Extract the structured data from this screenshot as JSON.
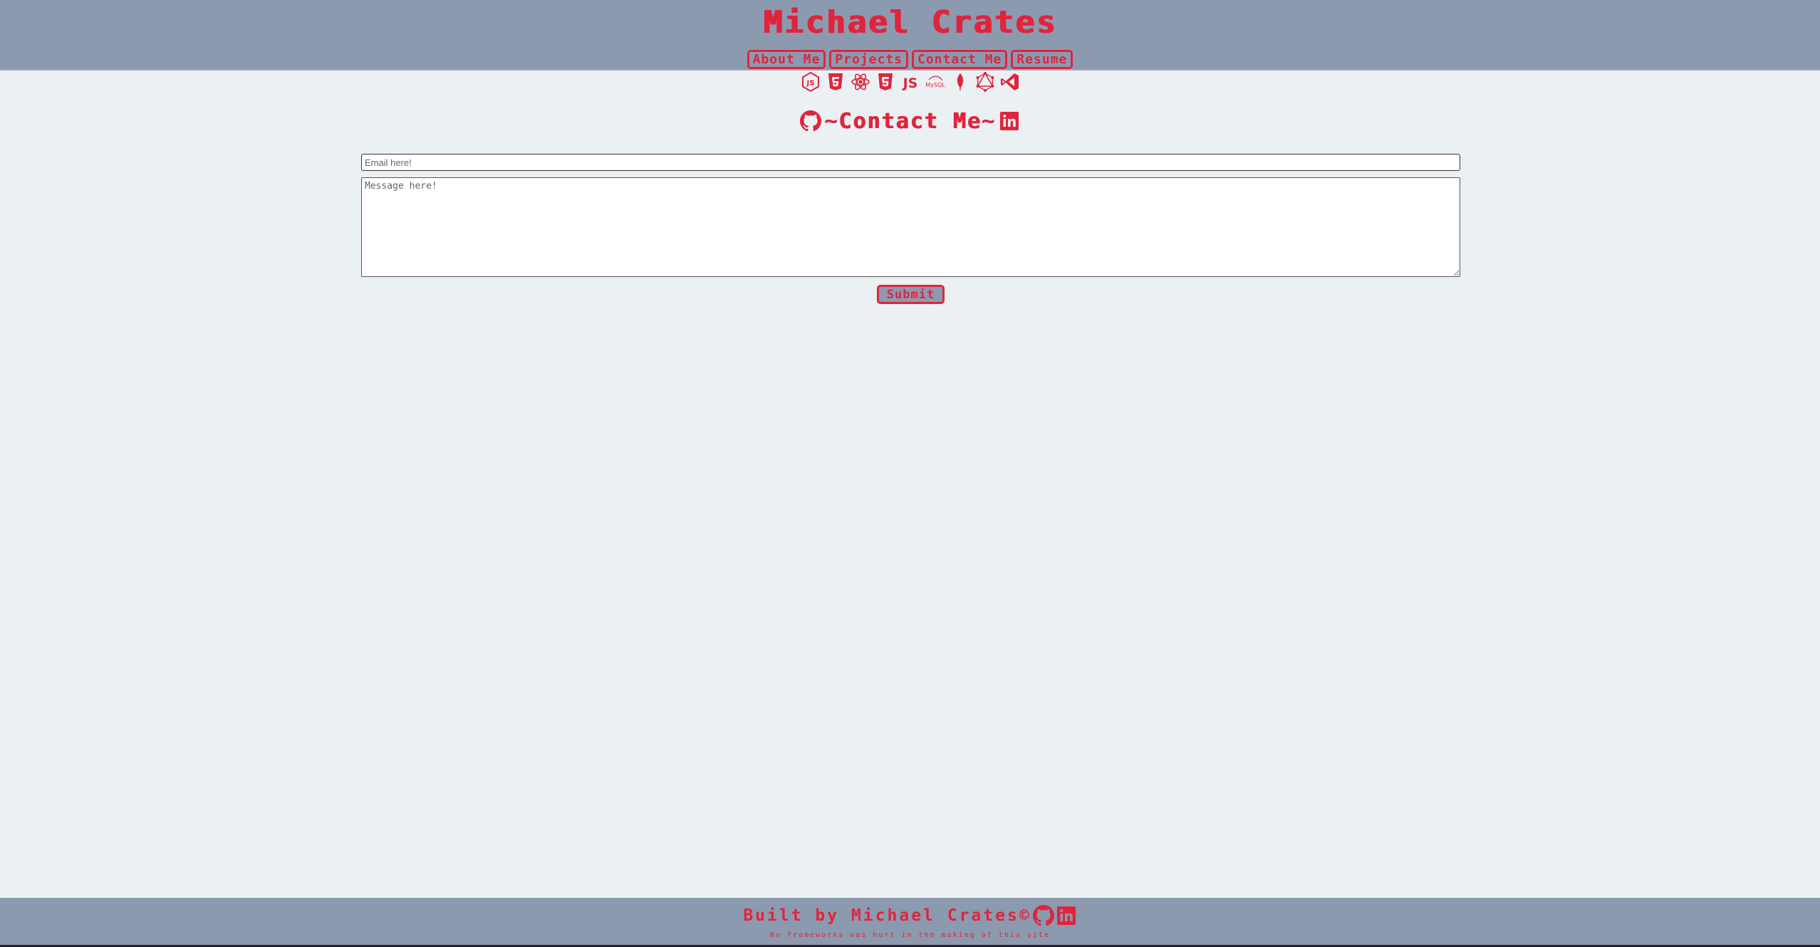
{
  "header": {
    "title": "Michael Crates",
    "nav": [
      {
        "label": "About Me"
      },
      {
        "label": "Projects"
      },
      {
        "label": "Contact Me"
      },
      {
        "label": "Resume"
      }
    ]
  },
  "tech_icons": [
    "nodejs-icon",
    "html5-icon",
    "react-icon",
    "css3-icon",
    "javascript-icon",
    "mysql-icon",
    "mongodb-icon",
    "graphql-icon",
    "vscode-icon"
  ],
  "tech_icon_text": {
    "javascript": "JS",
    "mysql": "MySQL"
  },
  "contact": {
    "heading": "~Contact Me~",
    "email_placeholder": "Email here!",
    "message_placeholder": "Message here!",
    "submit_label": "Submit"
  },
  "footer": {
    "text": "Built by Michael Crates©",
    "subtext": "No frameworks was hurt in the making of this site"
  },
  "colors": {
    "accent": "#e0243c",
    "header_bg": "#8c9ab0",
    "page_bg": "#ebf0f3"
  }
}
